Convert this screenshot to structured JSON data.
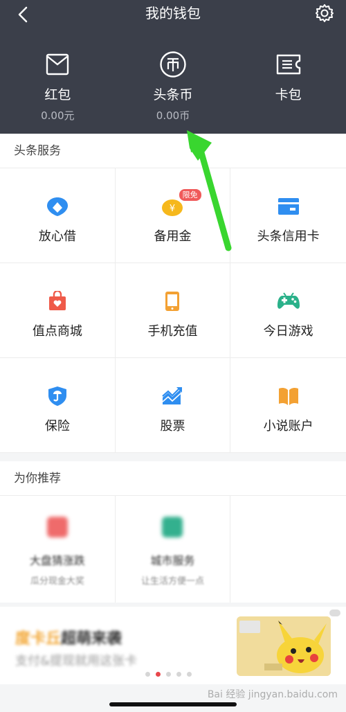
{
  "header": {
    "title": "我的钱包",
    "items": [
      {
        "label": "红包",
        "value": "0.00元",
        "icon": "envelope-icon"
      },
      {
        "label": "头条币",
        "value": "0.00币",
        "icon": "coin-icon"
      },
      {
        "label": "卡包",
        "value": "",
        "icon": "ticket-icon"
      }
    ],
    "accent": "#3b3f4a"
  },
  "services": {
    "title": "头条服务",
    "items": [
      {
        "label": "放心借",
        "icon": "shield-loan-icon",
        "color": "#2f8ef0"
      },
      {
        "label": "备用金",
        "icon": "money-bag-icon",
        "color": "#f6b81c",
        "badge": "限免"
      },
      {
        "label": "头条信用卡",
        "icon": "credit-card-icon",
        "color": "#2f8ef0"
      },
      {
        "label": "值点商城",
        "icon": "shop-bag-icon",
        "color": "#ef5a49"
      },
      {
        "label": "手机充值",
        "icon": "phone-icon",
        "color": "#f3a133"
      },
      {
        "label": "今日游戏",
        "icon": "gamepad-icon",
        "color": "#2bb18a"
      },
      {
        "label": "保险",
        "icon": "umbrella-shield-icon",
        "color": "#2f8ef0"
      },
      {
        "label": "股票",
        "icon": "stock-chart-icon",
        "color": "#2f8ef0"
      },
      {
        "label": "小说账户",
        "icon": "book-icon",
        "color": "#f3a133"
      }
    ]
  },
  "recommend": {
    "title": "为你推荐",
    "items": [
      {
        "title": "大盘猜涨跌",
        "sub": "瓜分现金大奖",
        "color": "#ef6b6b"
      },
      {
        "title": "城市服务",
        "sub": "让生活方便一点",
        "color": "#33b08e"
      }
    ]
  },
  "banner": {
    "title_part1": "度卡丘",
    "title_part2": "超萌来袭",
    "subtitle": "支付&提现就用这张卡"
  },
  "watermark": "Bai 经验 jingyan.baidu.com"
}
